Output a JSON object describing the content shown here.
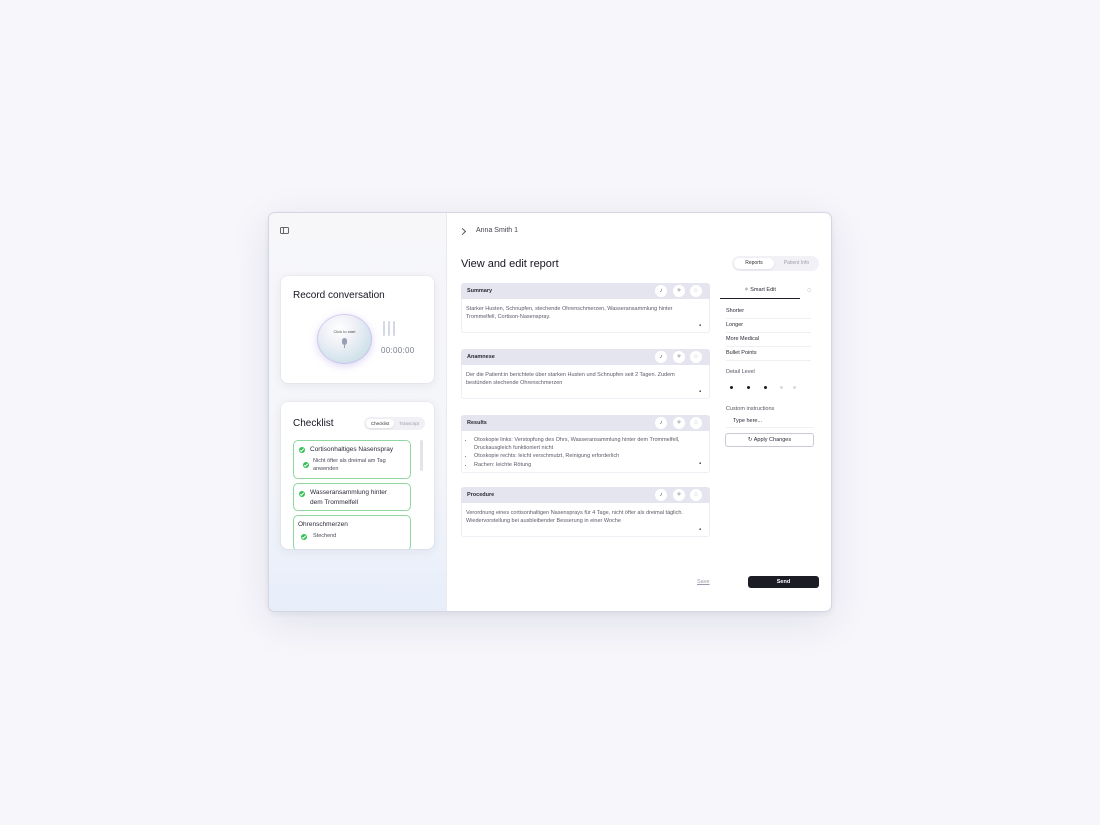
{
  "sidebar": {
    "record": {
      "title": "Record conversation",
      "orb_label": "Click to start",
      "timer": "00:00:00"
    },
    "checklist": {
      "title": "Checklist",
      "tabs": [
        "Checklist",
        "Transcript"
      ],
      "items": [
        {
          "label": "Cortisonhaltiges Nasenspray",
          "sub": "Nicht öfter als dreimal am Tag anwenden"
        },
        {
          "label": "Wasseransammlung hinter dem Trommelfell"
        },
        {
          "label": "Ohrenschmerzen",
          "sub": "Stechend"
        }
      ]
    }
  },
  "header": {
    "patient_name": "Anna Smith 1",
    "page_title": "View and edit report",
    "tabs": [
      "Reports",
      "Patient Info"
    ]
  },
  "sections": [
    {
      "title": "Summary",
      "text": "Starker Husten, Schnupfen, stechende Ohrenschmerzen, Wasseransammlung hinter Trommelfell, Cortison-Nasenspray."
    },
    {
      "title": "Anamnese",
      "text": "Der die Patient:in berichtete über starken Husten und Schnupfen seit 2 Tagen. Zudem bestünden stechende Ohrenschmerzen"
    },
    {
      "title": "Results",
      "bullets": [
        "Otoskopie links: Verstopfung des Ohrs, Wasseransammlung hinter dem Trommelfell, Druckausgleich funktioniert nicht",
        "Otoskopie rechts: leicht verschmutzt, Reinigung erforderlich",
        "Rachen: leichte Rötung"
      ]
    },
    {
      "title": "Procedure",
      "text": "Verordnung eines cortisonhaltigen Nasensprays für 4 Tage, nicht öfter als dreimal täglich. Wiedervorstellung bei ausbleibender Besserung in einer Woche"
    }
  ],
  "smart_edit": {
    "tab_label": "Smart Edit",
    "options": [
      "Shorter",
      "Longer",
      "More Medical",
      "Bullet Points"
    ],
    "detail_label": "Detail Level",
    "detail_level": 3,
    "detail_max": 5,
    "custom_label": "Custom instructions",
    "custom_placeholder": "Type here...",
    "apply_label": "Apply Changes"
  },
  "footer": {
    "save_label": "Save",
    "send_label": "Send"
  },
  "colors": {
    "check_green": "#34c055",
    "send_bg": "#1c1c24",
    "section_header_bg": "#e5e5ef"
  }
}
